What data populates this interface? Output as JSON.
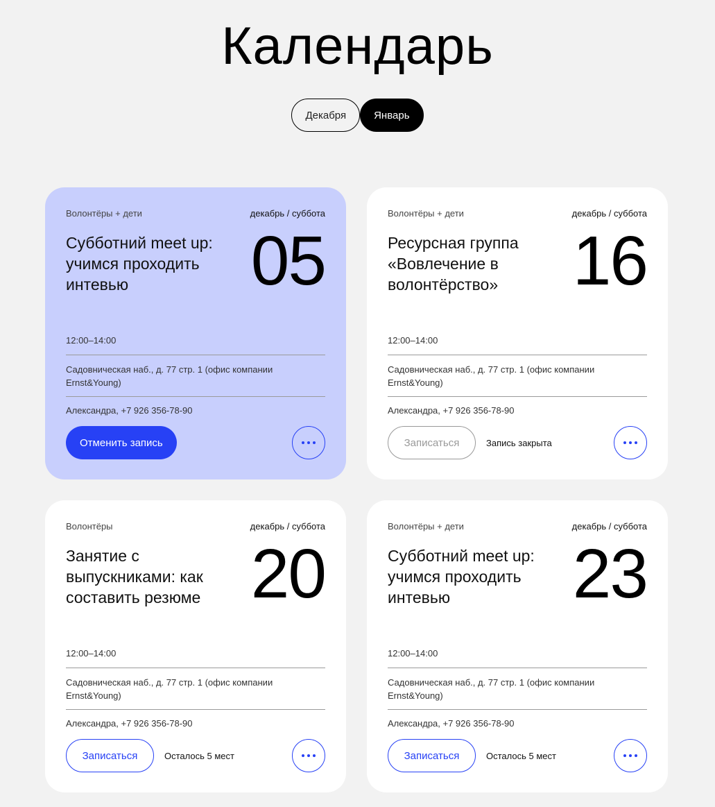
{
  "page": {
    "title": "Календарь"
  },
  "tabs": [
    {
      "label": "Декабря",
      "active": false
    },
    {
      "label": "Январь",
      "active": true
    }
  ],
  "cards": [
    {
      "category": "Волонтёры + дети",
      "date": "декабрь / суббота",
      "title": "Субботний meet up: учимся проходить интевью",
      "day": "05",
      "time": "12:00–14:00",
      "address": "Садовническая наб., д. 77 стр. 1 (офис компании Ernst&Young)",
      "contact": "Александра, +7 926 356-78-90",
      "action_label": "Отменить запись",
      "note": ""
    },
    {
      "category": "Волонтёры + дети",
      "date": "декабрь / суббота",
      "title": "Ресурсная группа «Вовлечение в волонтёрство»",
      "day": "16",
      "time": "12:00–14:00",
      "address": "Садовническая наб., д. 77 стр. 1 (офис компании Ernst&Young)",
      "contact": "Александра, +7 926 356-78-90",
      "action_label": "Записаться",
      "note": "Запись закрыта"
    },
    {
      "category": "Волонтёры",
      "date": "декабрь / суббота",
      "title": "Занятие с выпускниками: как составить резюме",
      "day": "20",
      "time": "12:00–14:00",
      "address": "Садовническая наб., д. 77 стр. 1 (офис компании Ernst&Young)",
      "contact": "Александра, +7 926 356-78-90",
      "action_label": "Записаться",
      "note": "Осталось 5 мест"
    },
    {
      "category": "Волонтёры + дети",
      "date": "декабрь / суббота",
      "title": "Субботний meet up: учимся проходить интевью",
      "day": "23",
      "time": "12:00–14:00",
      "address": "Садовническая наб., д. 77 стр. 1 (офис компании Ernst&Young)",
      "contact": "Александра, +7 926 356-78-90",
      "action_label": "Записаться",
      "note": "Осталось 5 мест"
    }
  ],
  "colors": {
    "accent": "#2741f5",
    "highlight": "#c8cffd",
    "background": "#f2f2f2"
  },
  "icons": {
    "more": "more-dots-icon"
  }
}
